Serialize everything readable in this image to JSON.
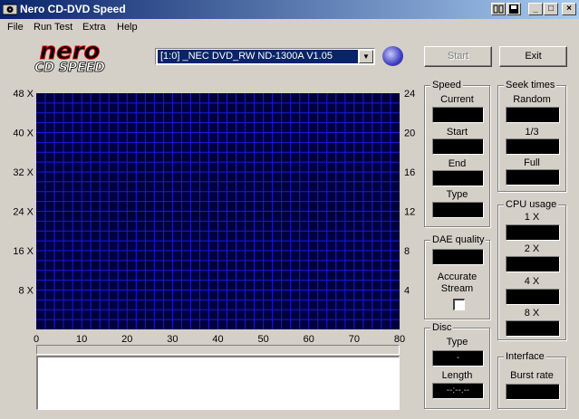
{
  "window": {
    "title": "Nero CD-DVD Speed"
  },
  "title_buttons": {
    "info": "",
    "minimize": "_",
    "maximize": "□",
    "close": "×"
  },
  "menu": [
    {
      "label": "File"
    },
    {
      "label": "Run Test"
    },
    {
      "label": "Extra"
    },
    {
      "label": "Help"
    }
  ],
  "logo": {
    "brand": "nero",
    "product": "CD SPEED"
  },
  "drive": {
    "selected": "[1:0]  _NEC DVD_RW ND-1300A V1.05",
    "arrow": "▼"
  },
  "buttons": {
    "start": "Start",
    "exit": "Exit"
  },
  "chart_data": {
    "type": "line",
    "x_ticks": [
      "0",
      "10",
      "20",
      "30",
      "40",
      "50",
      "60",
      "70",
      "80"
    ],
    "y_left_ticks": [
      "48 X",
      "40 X",
      "32 X",
      "24 X",
      "16 X",
      "8 X"
    ],
    "y_right_ticks": [
      "24",
      "20",
      "16",
      "12",
      "8",
      "4"
    ],
    "x_range": [
      0,
      80
    ],
    "y_left_range": [
      0,
      48
    ],
    "y_right_range": [
      0,
      24
    ],
    "grid": true,
    "series": [],
    "colors": {
      "background": "#000040",
      "grid": "#1a1ad8"
    }
  },
  "speed": {
    "title": "Speed",
    "current_label": "Current",
    "current_value": "",
    "start_label": "Start",
    "start_value": "",
    "end_label": "End",
    "end_value": "",
    "type_label": "Type",
    "type_value": ""
  },
  "seek": {
    "title": "Seek times",
    "random_label": "Random",
    "random_value": "",
    "third_label": "1/3",
    "third_value": "",
    "full_label": "Full",
    "full_value": ""
  },
  "cpu": {
    "title": "CPU usage",
    "x1_label": "1 X",
    "x1_value": "",
    "x2_label": "2 X",
    "x2_value": "",
    "x4_label": "4 X",
    "x4_value": "",
    "x8_label": "8 X",
    "x8_value": ""
  },
  "dae": {
    "title": "DAE quality",
    "value": "",
    "accurate_label": "Accurate",
    "stream_label": "Stream",
    "accurate_stream": false
  },
  "disc": {
    "title": "Disc",
    "type_label": "Type",
    "type_value": "-",
    "length_label": "Length",
    "length_value": "--:--.--"
  },
  "interface": {
    "title": "Interface",
    "burst_label": "Burst rate",
    "burst_value": ""
  }
}
